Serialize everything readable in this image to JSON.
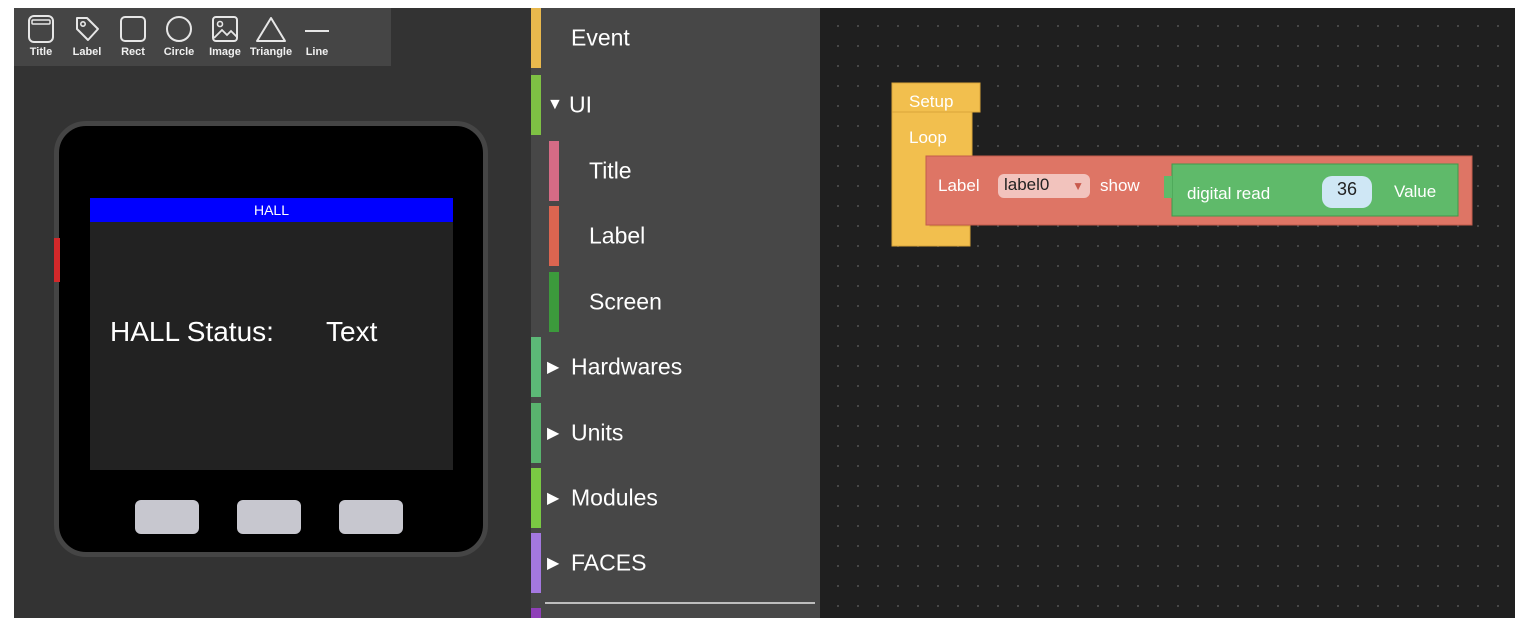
{
  "toolbar": {
    "tools": [
      {
        "label": "Title",
        "icon": "title-icon"
      },
      {
        "label": "Label",
        "icon": "label-tag-icon"
      },
      {
        "label": "Rect",
        "icon": "rectangle-icon"
      },
      {
        "label": "Circle",
        "icon": "circle-icon"
      },
      {
        "label": "Image",
        "icon": "image-icon"
      },
      {
        "label": "Triangle",
        "icon": "triangle-icon"
      },
      {
        "label": "Line",
        "icon": "line-icon"
      }
    ]
  },
  "device": {
    "title": "HALL",
    "status_label": "HALL Status:",
    "value_label": "Text"
  },
  "palette": {
    "items": [
      {
        "label": "Event",
        "color": "#e8b84d",
        "arrow": ""
      },
      {
        "label": "UI",
        "color": "#7ec144",
        "arrow": "▼"
      },
      {
        "label": "Title",
        "color": "#d56b85"
      },
      {
        "label": "Label",
        "color": "#db6550"
      },
      {
        "label": "Screen",
        "color": "#3c9a3c"
      },
      {
        "label": "Hardwares",
        "color": "#5cb877",
        "arrow": "▶"
      },
      {
        "label": "Units",
        "color": "#59b36e",
        "arrow": "▶"
      },
      {
        "label": "Modules",
        "color": "#7ac943",
        "arrow": "▶"
      },
      {
        "label": "FACES",
        "color": "#a478e0",
        "arrow": "▶"
      }
    ]
  },
  "blocks": {
    "setup": "Setup",
    "loop": "Loop",
    "label_prefix": "Label",
    "label_dropdown": "label0",
    "show": "show",
    "digital_read": "digital read",
    "pin": "36",
    "value": "Value",
    "colors": {
      "event": "#f2bf4e",
      "label": "#de7565",
      "hardware": "#5fba6a"
    }
  }
}
